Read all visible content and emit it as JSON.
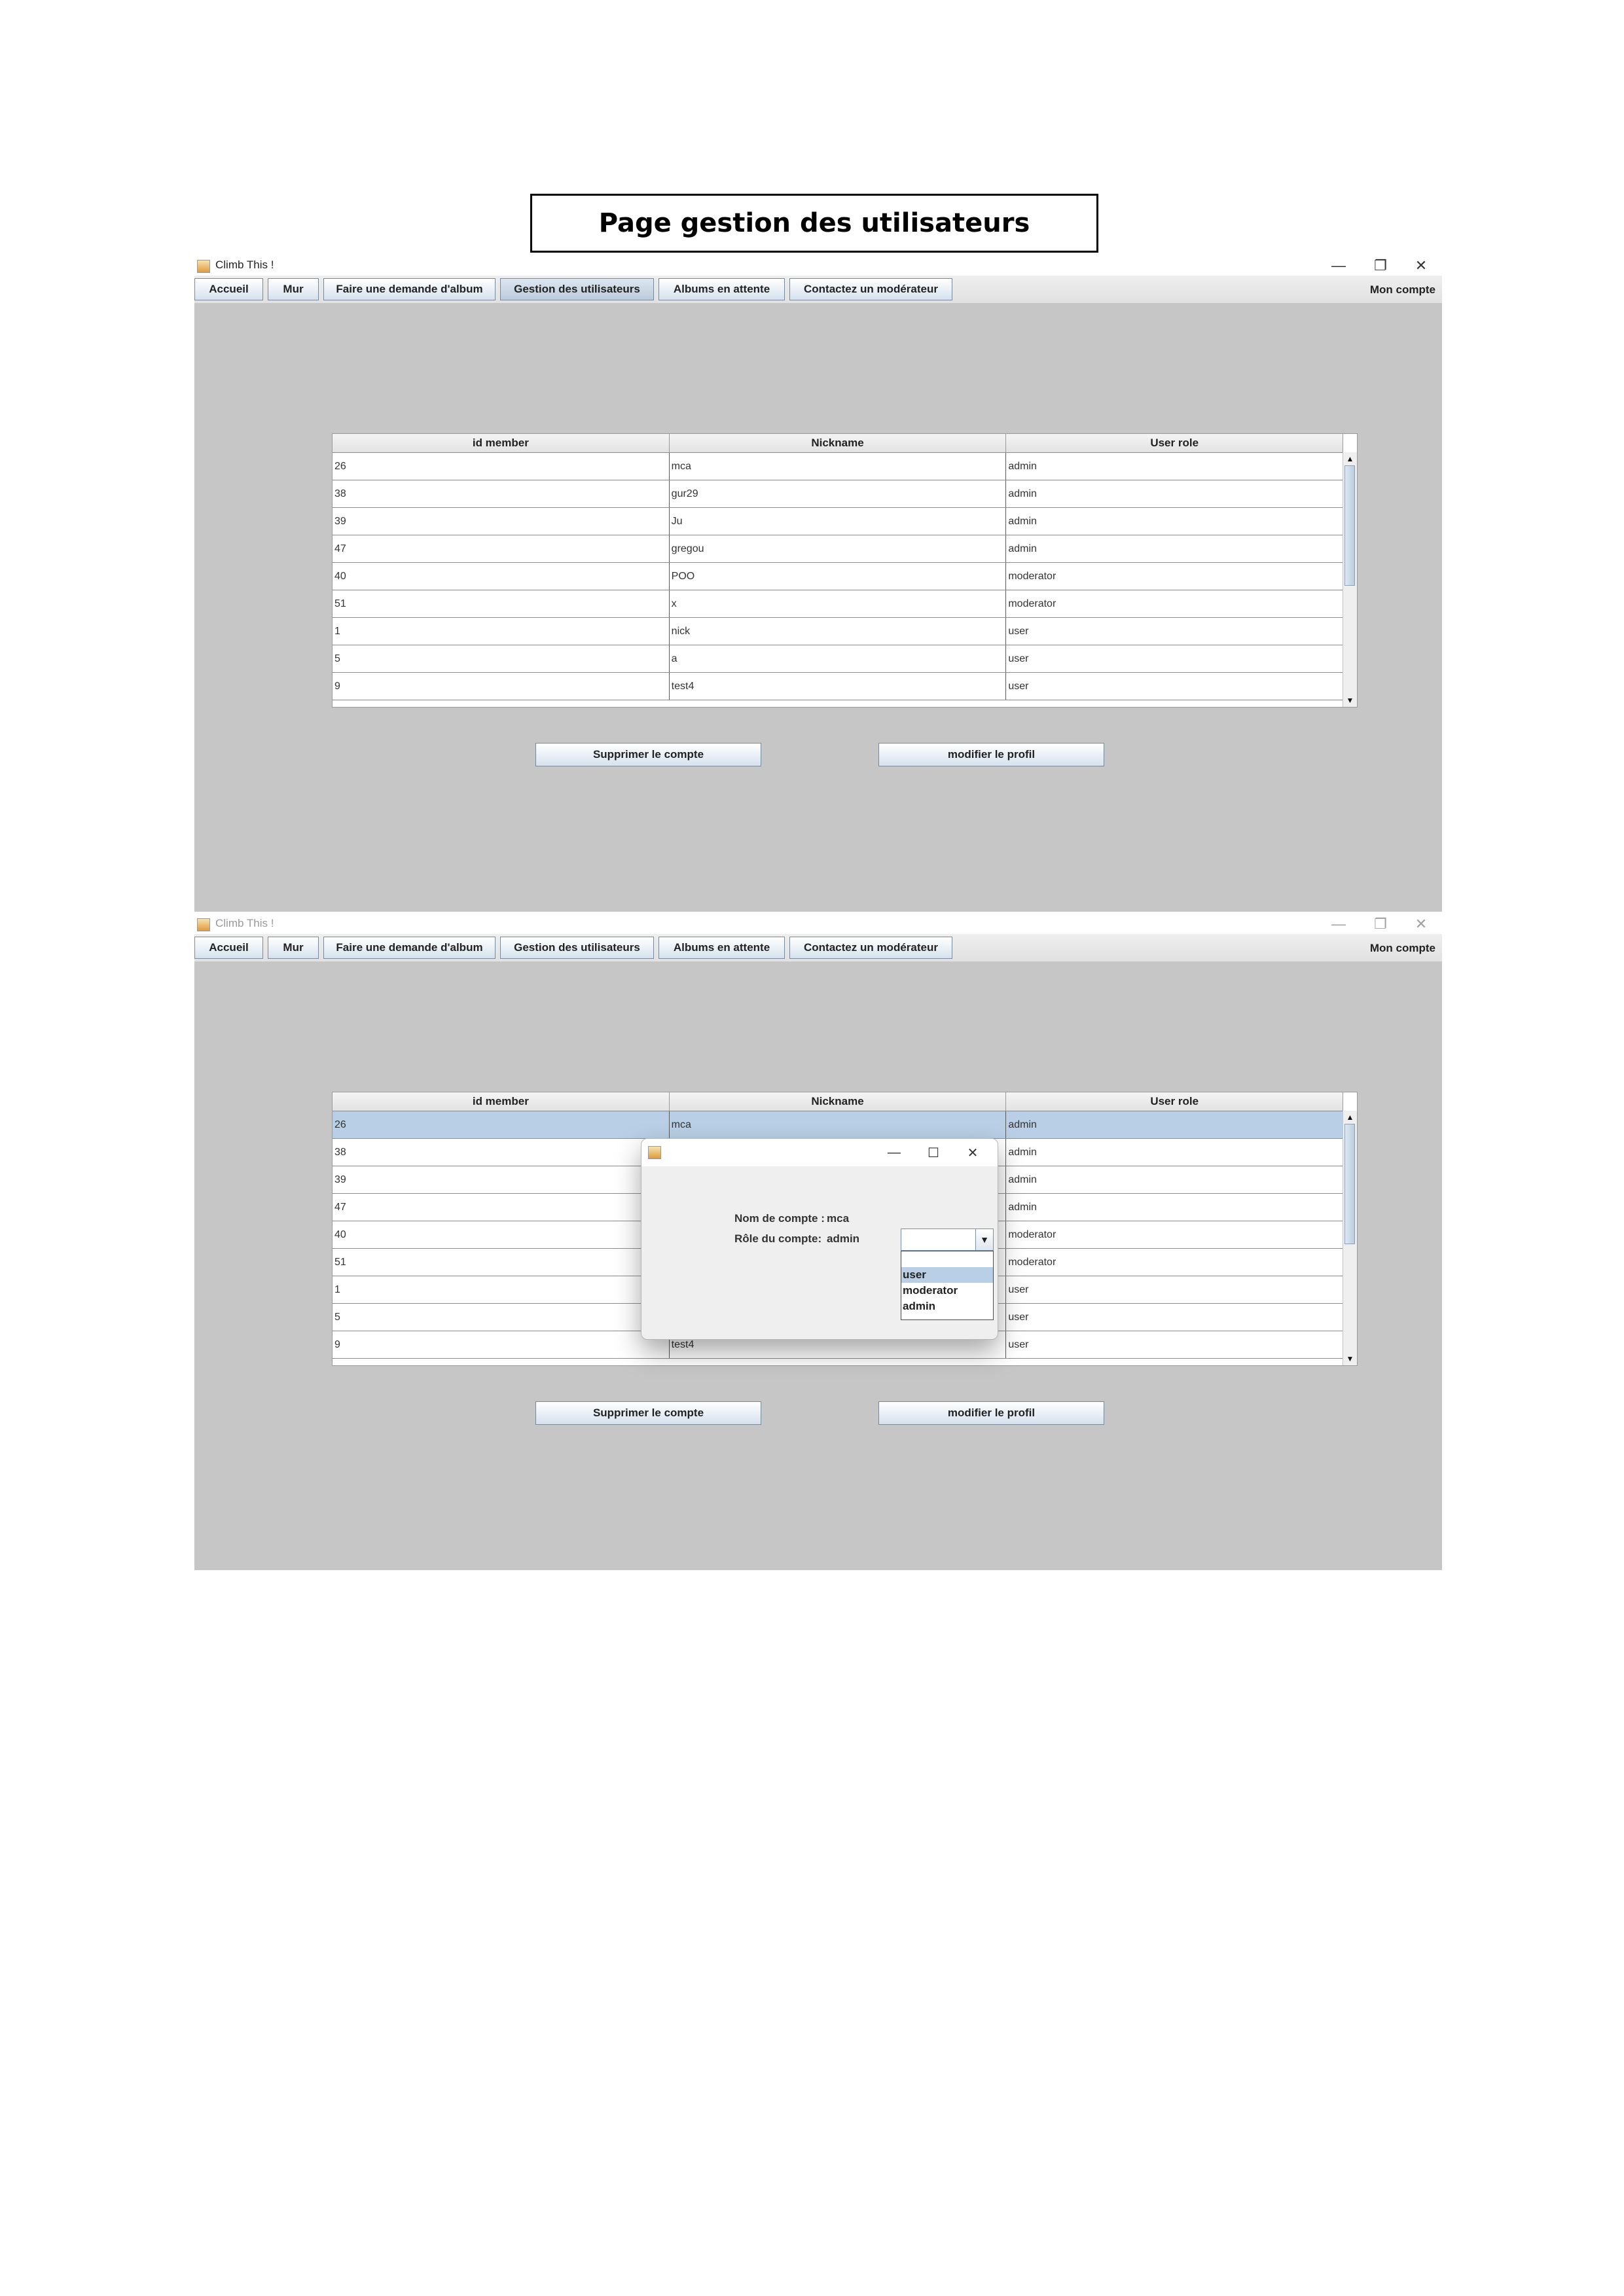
{
  "document": {
    "title": "Page gestion des utilisateurs"
  },
  "app": {
    "title": "Climb This !"
  },
  "window_controls": {
    "minimize": "—",
    "maximize": "❐",
    "close": "✕"
  },
  "nav": {
    "accueil": "Accueil",
    "mur": "Mur",
    "demande_album": "Faire une demande d'album",
    "gestion_utilisateurs": "Gestion des utilisateurs",
    "albums_attente": "Albums en attente",
    "contact_moderateur": "Contactez un modérateur",
    "mon_compte": "Mon compte"
  },
  "table": {
    "headers": [
      "id member",
      "Nickname",
      "User role"
    ],
    "rows": [
      [
        "26",
        "mca",
        "admin"
      ],
      [
        "38",
        "gur29",
        "admin"
      ],
      [
        "39",
        "Ju",
        "admin"
      ],
      [
        "47",
        "gregou",
        "admin"
      ],
      [
        "40",
        "POO",
        "moderator"
      ],
      [
        "51",
        "x",
        "moderator"
      ],
      [
        "1",
        "nick",
        "user"
      ],
      [
        "5",
        "a",
        "user"
      ],
      [
        "9",
        "test4",
        "user"
      ]
    ]
  },
  "actions": {
    "delete": "Supprimer le compte",
    "edit": "modifier le profil"
  },
  "dialog": {
    "account_name_label": "Nom de compte :",
    "account_name_value": "mca",
    "account_role_label": "Rôle du compte:",
    "account_role_value": "admin",
    "dialog_controls": {
      "minimize": "—",
      "maximize": "☐",
      "close": "✕"
    },
    "role_options": [
      "user",
      "moderator",
      "admin"
    ],
    "highlighted_option": "user"
  },
  "icons": {
    "scroll_up": "▲",
    "scroll_down": "▼",
    "combo_arrow": "▼"
  }
}
